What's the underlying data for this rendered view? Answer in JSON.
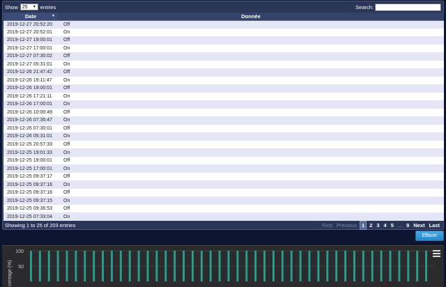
{
  "table": {
    "show_label": "Show",
    "entries_label": "entries",
    "page_size": "25",
    "search_label": "Search:",
    "search_value": "",
    "col_date": "Date",
    "col_value": "Donnée",
    "rows": [
      {
        "date": "2019-12-27 20:52:20",
        "value": "Off"
      },
      {
        "date": "2019-12-27 20:52:01",
        "value": "On"
      },
      {
        "date": "2019-12-27 19:00:01",
        "value": "Off"
      },
      {
        "date": "2019-12-27 17:00:01",
        "value": "On"
      },
      {
        "date": "2019-12-27 07:30:02",
        "value": "Off"
      },
      {
        "date": "2019-12-27 05:31:01",
        "value": "On"
      },
      {
        "date": "2019-12-26 21:47:42",
        "value": "Off"
      },
      {
        "date": "2019-12-26 19:11:47",
        "value": "On"
      },
      {
        "date": "2019-12-26 19:00:01",
        "value": "Off"
      },
      {
        "date": "2019-12-26 17:21:11",
        "value": "On"
      },
      {
        "date": "2019-12-26 17:00:01",
        "value": "On"
      },
      {
        "date": "2019-12-26 10:00:49",
        "value": "Off"
      },
      {
        "date": "2019-12-26 07:35:47",
        "value": "On"
      },
      {
        "date": "2019-12-26 07:30:01",
        "value": "Off"
      },
      {
        "date": "2019-12-26 05:31:01",
        "value": "On"
      },
      {
        "date": "2019-12-25 20:57:33",
        "value": "Off"
      },
      {
        "date": "2019-12-25 19:01:33",
        "value": "On"
      },
      {
        "date": "2019-12-25 19:00:01",
        "value": "Off"
      },
      {
        "date": "2019-12-25 17:00:01",
        "value": "On"
      },
      {
        "date": "2019-12-25 09:37:17",
        "value": "Off"
      },
      {
        "date": "2019-12-25 09:37:16",
        "value": "On"
      },
      {
        "date": "2019-12-25 09:37:16",
        "value": "Off"
      },
      {
        "date": "2019-12-25 09:37:15",
        "value": "On"
      },
      {
        "date": "2019-12-25 09:36:53",
        "value": "Off"
      },
      {
        "date": "2019-12-25 07:33:04",
        "value": "On"
      }
    ],
    "info": "Showing 1 to 25 of 203 entries",
    "pager": {
      "first": "First",
      "previous": "Previous",
      "pages": [
        "1",
        "2",
        "3",
        "4",
        "5"
      ],
      "current_page": "1",
      "ellipsis": "...",
      "last_page": "9",
      "next": "Next",
      "last": "Last"
    }
  },
  "effacer_label": "Effacer",
  "chart": {
    "ylabel": "centage (%)",
    "y_ticks": [
      "100",
      "50"
    ],
    "menu_icon": "hamburger-menu-icon",
    "colors": {
      "background": "#2b2b2d",
      "bar": "#2a9d8f",
      "grid": "#555555"
    }
  },
  "chart_data": {
    "type": "bar",
    "ylabel": "centage (%)",
    "ylim": [
      0,
      100
    ],
    "values": [
      100,
      0,
      100,
      0,
      100,
      0,
      100,
      0,
      100,
      0,
      100,
      0,
      100,
      0,
      100,
      0,
      100,
      0,
      100,
      0,
      100,
      0,
      100,
      0,
      100,
      0,
      100,
      0,
      100,
      0,
      100,
      0,
      100,
      0,
      100,
      0,
      100,
      0,
      100,
      0,
      100,
      0,
      100,
      0,
      100,
      0,
      100,
      0,
      100,
      0,
      100,
      0,
      100,
      0,
      100,
      0,
      100,
      0,
      100,
      0,
      100,
      0,
      100,
      0,
      100,
      0,
      100,
      0,
      100,
      0,
      100,
      0,
      100,
      0,
      100,
      0,
      100,
      0,
      100,
      0,
      100,
      0,
      100,
      0,
      100,
      0,
      100,
      0,
      100,
      0
    ]
  }
}
